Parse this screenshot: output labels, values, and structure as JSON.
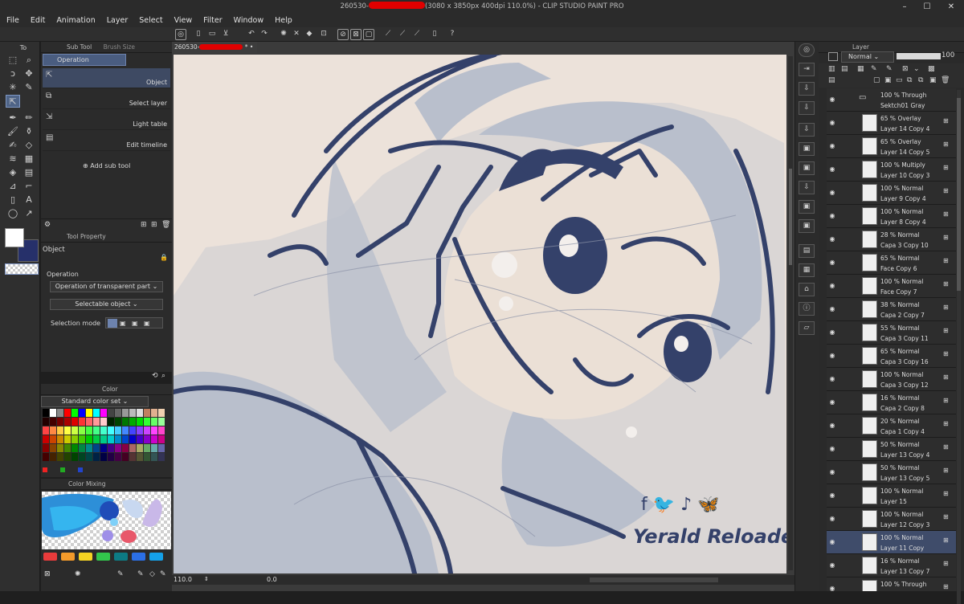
{
  "window": {
    "title_prefix": "260530-",
    "title_suffix": "(3080 x 3850px 400dpi 110.0%)  - CLIP STUDIO PAINT PRO",
    "min_icon": "–",
    "max_icon": "☐",
    "close_icon": "✕"
  },
  "menu": [
    "File",
    "Edit",
    "Animation",
    "Layer",
    "Select",
    "View",
    "Filter",
    "Window",
    "Help"
  ],
  "subtool_panel": {
    "tab_tool": "To",
    "tab_subtool": "Sub Tool",
    "tab_brushsize": "Brush Size",
    "group": "Operation",
    "items": [
      "Object",
      "Select layer",
      "Light table",
      "Edit timeline"
    ],
    "add_label": "Add sub tool"
  },
  "tool_property": {
    "tab": "Tool Property",
    "title": "Object",
    "section": "Operation",
    "dropdown1": "Operation of transparent part",
    "dropdown2": "Selectable object",
    "mode_label": "Selection mode"
  },
  "color_panel": {
    "tab": "Color",
    "set_name": "Standard color set"
  },
  "color_mixing": {
    "tab": "Color Mixing"
  },
  "document": {
    "tab_prefix": "260530-",
    "tab_suffix": "*"
  },
  "canvas": {
    "watermark": "Yerald Reloaded"
  },
  "status": {
    "zoom": "110.0",
    "angle": "0.0"
  },
  "layer_panel": {
    "tab": "Layer",
    "blend_mode": "Normal",
    "opacity": "100",
    "layers": [
      {
        "mode": "100 % Through",
        "name": "Sektch01 Gray",
        "folder": true
      },
      {
        "mode": "65 % Overlay",
        "name": "Layer 14 Copy 4"
      },
      {
        "mode": "65 % Overlay",
        "name": "Layer 14 Copy 5"
      },
      {
        "mode": "100 % Multiply",
        "name": "Layer 10 Copy 3"
      },
      {
        "mode": "100 % Normal",
        "name": "Layer 9 Copy 4"
      },
      {
        "mode": "100 % Normal",
        "name": "Layer 8 Copy 4"
      },
      {
        "mode": "28 % Normal",
        "name": "Capa 3 Copy 10"
      },
      {
        "mode": "65 % Normal",
        "name": "Face Copy 6"
      },
      {
        "mode": "100 % Normal",
        "name": "Face Copy 7"
      },
      {
        "mode": "38 % Normal",
        "name": "Capa 2 Copy 7"
      },
      {
        "mode": "55 % Normal",
        "name": "Capa 3 Copy 11"
      },
      {
        "mode": "65 % Normal",
        "name": "Capa 3 Copy 16"
      },
      {
        "mode": "100 % Normal",
        "name": "Capa 3 Copy 12"
      },
      {
        "mode": "16 % Normal",
        "name": "Capa 2 Copy 8"
      },
      {
        "mode": "20 % Normal",
        "name": "Capa 1 Copy 4"
      },
      {
        "mode": "50 % Normal",
        "name": "Layer 13 Copy 4"
      },
      {
        "mode": "50 % Normal",
        "name": "Layer 13 Copy 5"
      },
      {
        "mode": "100 % Normal",
        "name": "Layer 15"
      },
      {
        "mode": "100 % Normal",
        "name": "Layer 12 Copy 3"
      },
      {
        "mode": "100 % Normal",
        "name": "Layer 11 Copy",
        "selected": true
      },
      {
        "mode": "16 % Normal",
        "name": "Layer 13 Copy 7"
      },
      {
        "mode": "100 % Through",
        "name": ""
      }
    ]
  },
  "colors": {
    "main_color": "#ffffff",
    "sub_color": "#26306a",
    "line_color": "#34416a",
    "accent": "#4f6487"
  }
}
